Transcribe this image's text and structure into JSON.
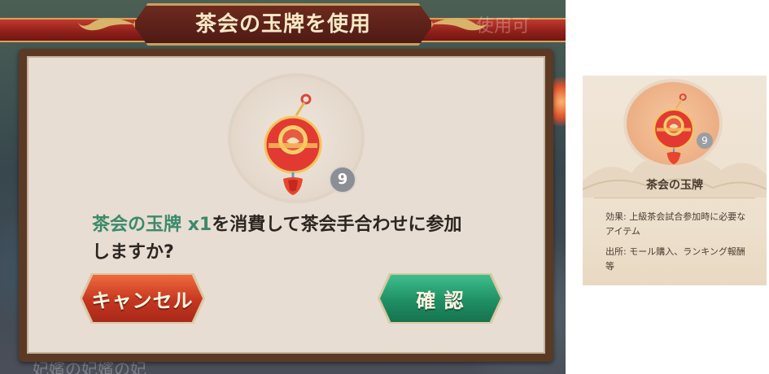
{
  "dialog": {
    "title": "茶会の玉牌を使用",
    "item": {
      "icon": "tea-party-jade-token-icon",
      "count": "9"
    },
    "message": {
      "item_name": "茶会の玉牌",
      "quantity": "x1",
      "line1_rest": "を消費して茶会手合わせに参加",
      "line2": "しますか?"
    },
    "buttons": {
      "cancel": "キャンセル",
      "confirm": "確 認"
    }
  },
  "tooltip": {
    "item_icon": "tea-party-jade-token-icon",
    "count": "9",
    "name": "茶会の玉牌",
    "effect": "効果: 上級茶会試合参加時に必要なアイテム",
    "source": "出所: モール購入、ランキング報酬等"
  },
  "background": {
    "partial_text_top": "使用可",
    "partial_text_bottom": "妃嬪の妃嬪の妃"
  },
  "colors": {
    "highlight_green": "#3b8a6b",
    "cancel_red": "#c5361f",
    "confirm_green": "#1f8f64",
    "title_gold": "#caa05c"
  }
}
